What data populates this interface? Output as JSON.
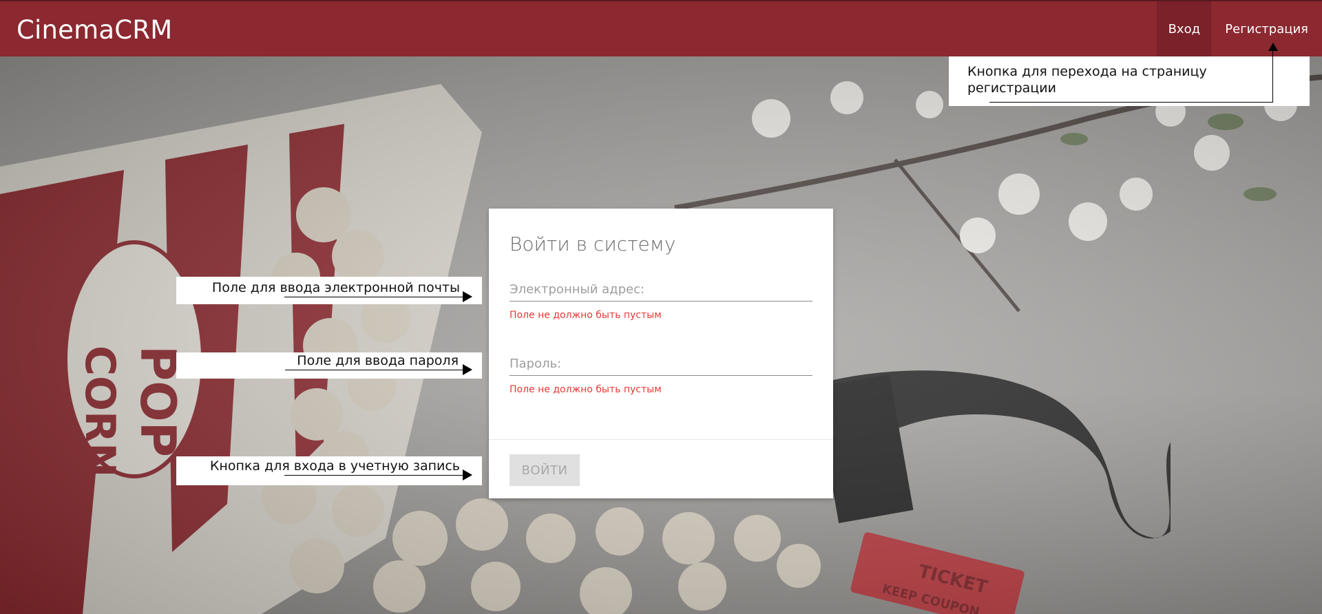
{
  "header": {
    "brand": "CinemaCRM",
    "nav": [
      {
        "label": "Вход",
        "active": true
      },
      {
        "label": "Регистрация",
        "active": false
      }
    ],
    "bar_color": "#8b2830",
    "active_color": "#7a2129"
  },
  "login_card": {
    "title": "Войти в систему",
    "email": {
      "placeholder": "Электронный адрес:",
      "value": "",
      "error": "Поле не должно быть пустым"
    },
    "password": {
      "placeholder": "Пароль:",
      "value": "",
      "error": "Поле не должно быть пустым"
    },
    "submit_label": "ВОЙТИ",
    "submit_disabled": true,
    "error_color": "#e53935"
  },
  "annotations": {
    "email_field": "Поле для ввода электронной почты",
    "password_field": "Поле для ввода пароля",
    "login_button": "Кнопка для входа в учетную запись",
    "register_button": "Кнопка для перехода на страницу регистрации"
  }
}
